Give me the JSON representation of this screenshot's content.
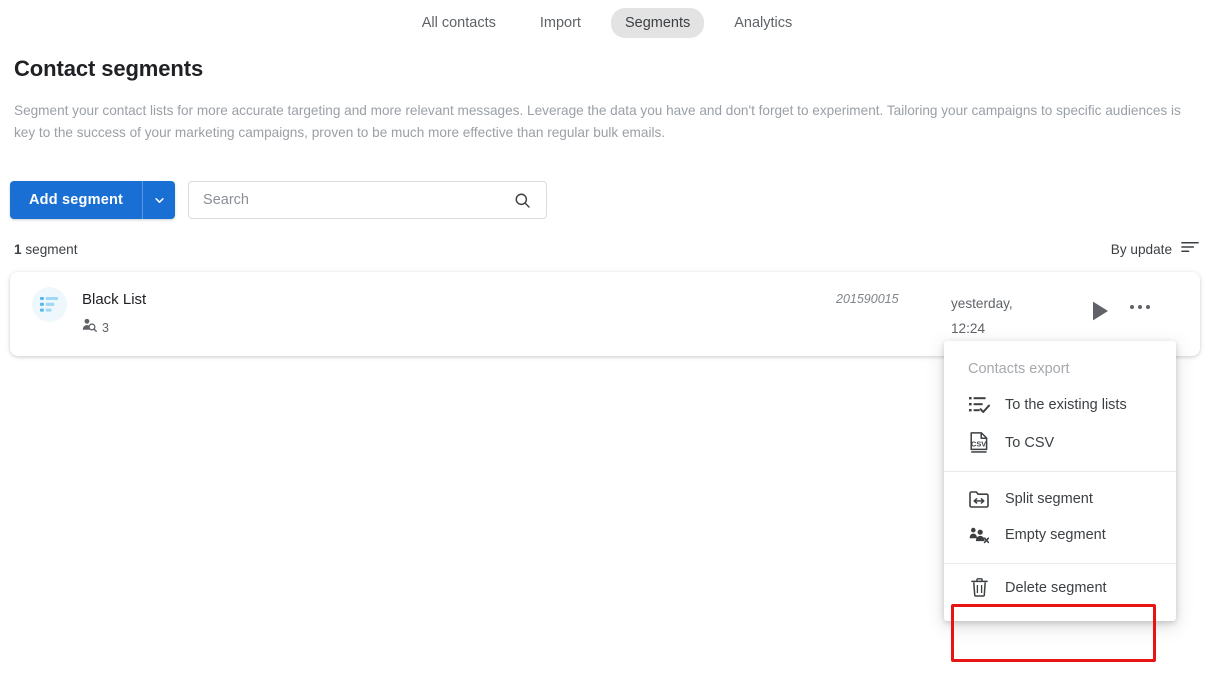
{
  "tabs": [
    {
      "label": "All contacts",
      "active": false
    },
    {
      "label": "Import",
      "active": false
    },
    {
      "label": "Segments",
      "active": true
    },
    {
      "label": "Analytics",
      "active": false
    }
  ],
  "page": {
    "title": "Contact segments",
    "description": "Segment your contact lists for more accurate targeting and more relevant messages. Leverage the data you have and don't forget to experiment. Tailoring your campaigns to specific audiences is key to the success of your marketing campaigns, proven to be much more effective than regular bulk emails."
  },
  "actions": {
    "add_segment_label": "Add segment",
    "add_segment_caret_icon": "chevron-down-icon",
    "search_placeholder": "Search",
    "search_value": "",
    "search_icon": "search-icon"
  },
  "toolbar": {
    "count_number": "1",
    "count_label": "segment",
    "sort_label": "By update",
    "sort_icon": "sort-icon"
  },
  "segment": {
    "avatar_icon": "segment-icon",
    "name": "Black List",
    "contacts_icon": "contact-search-icon",
    "contacts_count": "3",
    "id": "201590015",
    "date_line1": "yesterday,",
    "date_line2": "12:24",
    "play_icon": "play-icon",
    "more_icon": "more-options-icon"
  },
  "menu": {
    "header": "Contacts export",
    "groups": [
      {
        "items": [
          {
            "label": "To the existing lists",
            "icon": "list-check-icon"
          },
          {
            "label": "To CSV",
            "icon": "csv-file-icon"
          }
        ]
      },
      {
        "items": [
          {
            "label": "Split segment",
            "icon": "split-segment-icon"
          },
          {
            "label": "Empty segment",
            "icon": "empty-segment-icon"
          }
        ]
      },
      {
        "items": [
          {
            "label": "Delete segment",
            "icon": "trash-icon"
          }
        ]
      }
    ]
  },
  "colors": {
    "accent_blue": "#1a6fd4",
    "highlight_red": "#e81313",
    "tab_active_bg": "#e3e3e3",
    "muted_text": "#9aa0a6"
  }
}
